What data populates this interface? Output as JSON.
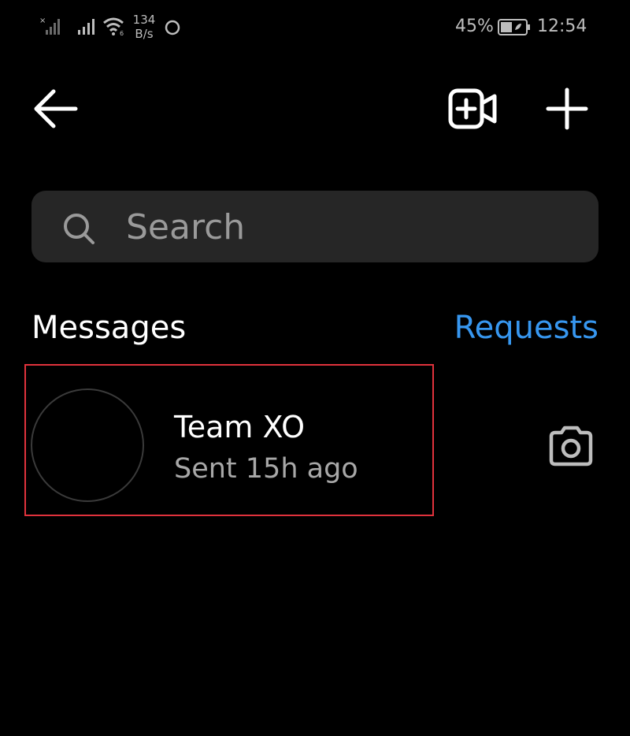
{
  "status_bar": {
    "net_speed_value": "134",
    "net_speed_unit": "B/s",
    "battery_percent": "45%",
    "time": "12:54"
  },
  "header": {
    "back_icon": "back-arrow-icon",
    "video_icon": "video-call-add-icon",
    "new_message_icon": "plus-icon"
  },
  "search": {
    "placeholder": "Search"
  },
  "sections": {
    "messages_title": "Messages",
    "requests_label": "Requests"
  },
  "threads": [
    {
      "name": "Team XO",
      "meta": "Sent 15h ago",
      "action_icon": "camera-icon"
    }
  ],
  "colors": {
    "background": "#000000",
    "search_bg": "#262626",
    "accent_blue": "#3797f0",
    "highlight_border": "#e0323c",
    "secondary_text": "#a8a8a8"
  }
}
